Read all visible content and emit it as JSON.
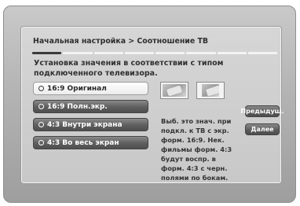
{
  "header": {
    "title": "Начальная настройка > Соотношение ТВ",
    "progress_segments": 8,
    "progress_done": 1
  },
  "main": {
    "description": "Установка значения в соответствии с типом подключенного телевизора.",
    "options": [
      {
        "label": "16:9 Оригинал",
        "selected": true
      },
      {
        "label": "16:9 Полн.экр.",
        "selected": false
      },
      {
        "label": "4:3 Внутри экрана",
        "selected": false
      },
      {
        "label": "4:3 Во весь экран",
        "selected": false
      }
    ],
    "help_text": "Выб. это знач. при подкл. к ТВ с экр. форм. 16:9. Нек. фильмы форм. 4:3 будут воспр. в форм. 4:3 с черн. полями по бокам.",
    "preview_icons": [
      "tv-43-screen-icon",
      "tv-169-screen-icon"
    ]
  },
  "buttons": {
    "prev_label": "Предыдущ.",
    "next_label": "Далее"
  },
  "colors": {
    "background": "#b3b3b3",
    "panel": "#d0d0d0",
    "selected_option": "#f0f0f0",
    "unselected_option": "#5e5e5e"
  }
}
